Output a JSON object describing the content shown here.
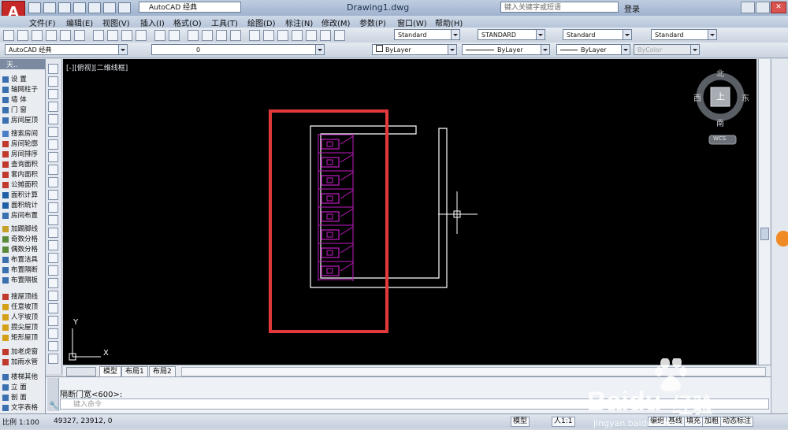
{
  "titlebar": {
    "app_letter": "A",
    "workspace": "AutoCAD 经典",
    "document_title": "Drawing1.dwg",
    "search_placeholder": "键入关键字或短语",
    "login": "登录"
  },
  "menu": [
    "文件(F)",
    "编辑(E)",
    "视图(V)",
    "插入(I)",
    "格式(O)",
    "工具(T)",
    "绘图(D)",
    "标注(N)",
    "修改(M)",
    "参数(P)",
    "窗口(W)",
    "帮助(H)"
  ],
  "styles": {
    "text_style": "Standard",
    "dim_style": "STANDARD",
    "table_style": "Standard",
    "multileader_style": "Standard"
  },
  "layers": {
    "workspace": "AutoCAD 经典",
    "current_layer": "0",
    "color": "ByLayer",
    "linetype": "ByLayer",
    "lineweight": "ByLayer",
    "plotstyle": "ByColor"
  },
  "palette": {
    "title": "天..",
    "items": [
      {
        "label": "设    置",
        "color": "#3a6fb0"
      },
      {
        "label": "轴网柱子",
        "color": "#3a6fb0"
      },
      {
        "label": "墙    体",
        "color": "#3a6fb0"
      },
      {
        "label": "门    窗",
        "color": "#3a6fb0"
      },
      {
        "label": "房间屋顶",
        "color": "#3a6fb0"
      },
      {
        "label": "搜索房间",
        "color": "#4b7fc9"
      },
      {
        "label": "房间轮廓",
        "color": "#c0392b"
      },
      {
        "label": "房间排序",
        "color": "#c0392b"
      },
      {
        "label": "查询面积",
        "color": "#c0392b"
      },
      {
        "label": "套内面积",
        "color": "#c0392b"
      },
      {
        "label": "公摊面积",
        "color": "#c0392b"
      },
      {
        "label": "面积计算",
        "color": "#1f5fa6"
      },
      {
        "label": "面积统计",
        "color": "#1f5fa6"
      },
      {
        "label": "房间布置",
        "color": "#3a6fb0"
      },
      {
        "label": "加踢脚线",
        "color": "#c7a02a"
      },
      {
        "label": "奇数分格",
        "color": "#5a8a3a"
      },
      {
        "label": "偶数分格",
        "color": "#5a8a3a"
      },
      {
        "label": "布置洁具",
        "color": "#3a6fb0"
      },
      {
        "label": "布置隔断",
        "color": "#3a6fb0"
      },
      {
        "label": "布置隔板",
        "color": "#3a6fb0"
      },
      {
        "label": "搜屋顶线",
        "color": "#c0392b"
      },
      {
        "label": "任意坡顶",
        "color": "#d4a017"
      },
      {
        "label": "人字坡顶",
        "color": "#d4a017"
      },
      {
        "label": "攒尖屋顶",
        "color": "#d4a017"
      },
      {
        "label": "矩形屋顶",
        "color": "#d4a017"
      },
      {
        "label": "加老虎窗",
        "color": "#c0392b"
      },
      {
        "label": "加雨水管",
        "color": "#c0392b"
      },
      {
        "label": "楼梯其他",
        "color": "#3a6fb0"
      },
      {
        "label": "立    面",
        "color": "#3a6fb0"
      },
      {
        "label": "剖    面",
        "color": "#3a6fb0"
      },
      {
        "label": "文字表格",
        "color": "#3a6fb0"
      }
    ]
  },
  "viewport": {
    "label": "[-][俯视][二维线框]",
    "viewcube": {
      "top": "上",
      "north": "北",
      "south": "南",
      "east": "东",
      "west": "西",
      "wcs": "WCS"
    },
    "ucs": {
      "x": "X",
      "y": "Y"
    }
  },
  "tabs": [
    "模型",
    "布局1",
    "布局2"
  ],
  "command": {
    "history": "隔断门宽<600>:",
    "placeholder": "键入命令"
  },
  "status": {
    "scale": "比例 1:100",
    "coords": "49327, 23912, 0",
    "model": "模型",
    "annotation_scale": "人1:1",
    "buttons": [
      "编组",
      "基线",
      "填充",
      "加粗",
      "动态标注"
    ]
  },
  "watermark": {
    "brand": "Baidu",
    "cn": "经验",
    "url": "jingyan.baidu.com"
  },
  "colors": {
    "canvas": "#000000",
    "drawing": "#ffffff",
    "fixtures": "#c21ac2",
    "highlight": "#e23a3a"
  }
}
